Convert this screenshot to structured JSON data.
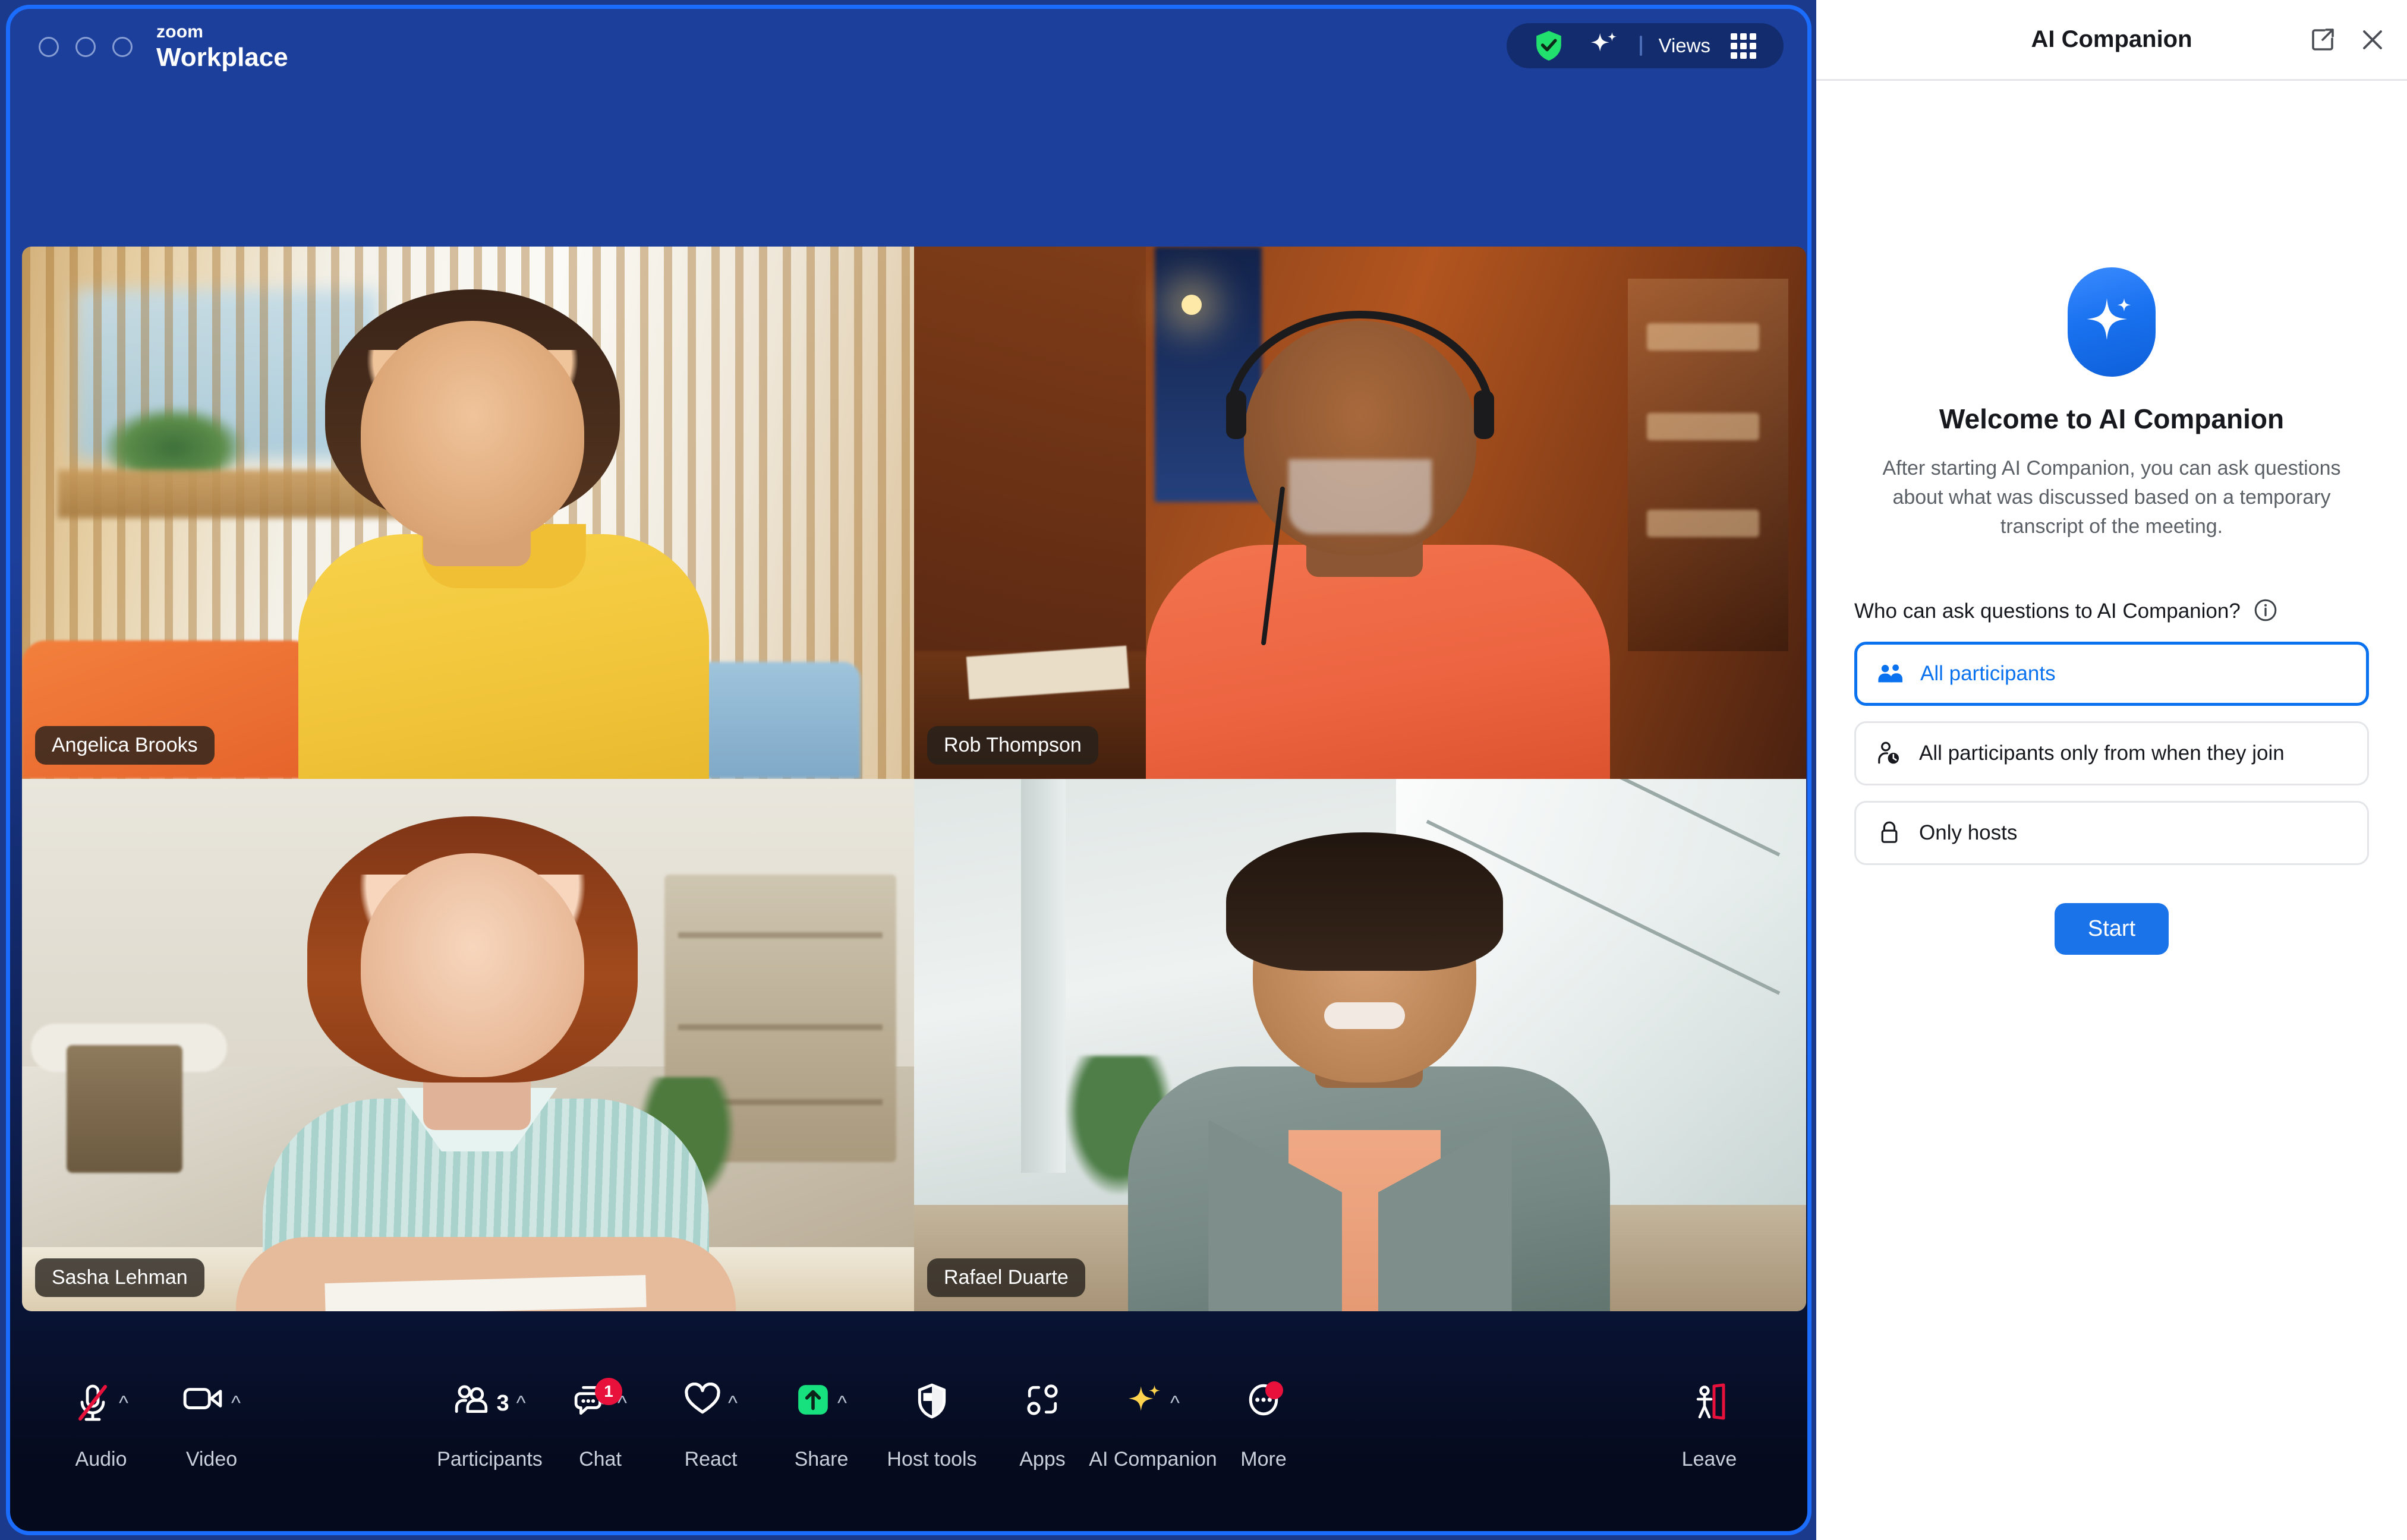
{
  "window": {
    "brand_line1": "zoom",
    "brand_line2": "Workplace",
    "traffic_lights": [
      "close",
      "minimize",
      "maximize"
    ]
  },
  "top_right_controls": {
    "encryption_icon": "shield-check-icon",
    "ai_icon": "ai-sparkle-icon",
    "views_label": "Views",
    "views_grid_icon": "grid-icon"
  },
  "video_grid": {
    "participants": [
      {
        "name": "Angelica Brooks"
      },
      {
        "name": "Rob Thompson"
      },
      {
        "name": "Sasha Lehman"
      },
      {
        "name": "Rafael Duarte"
      }
    ]
  },
  "toolbar": {
    "left": [
      {
        "label": "Audio",
        "icon": "microphone-muted-icon",
        "caret": "^",
        "muted": true
      },
      {
        "label": "Video",
        "icon": "video-camera-icon",
        "caret": "^"
      }
    ],
    "center": [
      {
        "label": "Participants",
        "icon": "participants-icon",
        "caret": "^",
        "count": "3"
      },
      {
        "label": "Chat",
        "icon": "chat-bubble-icon",
        "caret": "^",
        "badge": "1"
      },
      {
        "label": "React",
        "icon": "heart-icon",
        "caret": "^"
      },
      {
        "label": "Share",
        "icon": "share-screen-icon",
        "caret": "^"
      },
      {
        "label": "Host tools",
        "icon": "shield-icon"
      },
      {
        "label": "Apps",
        "icon": "apps-icon"
      },
      {
        "label": "AI Companion",
        "icon": "ai-sparkle-icon",
        "caret": "^"
      },
      {
        "label": "More",
        "icon": "more-ellipsis-icon",
        "dot_badge": true
      }
    ],
    "right": [
      {
        "label": "Leave",
        "icon": "leave-door-icon"
      }
    ]
  },
  "ai_panel": {
    "title": "AI Companion",
    "popout_icon": "popout-icon",
    "close_icon": "close-icon",
    "logo_icon": "ai-sparkle-icon",
    "welcome_title": "Welcome to AI Companion",
    "welcome_desc": "After starting AI Companion, you can ask questions about what was discussed based on a temporary transcript of the meeting.",
    "question_label": "Who can ask questions to AI Companion?",
    "info_icon": "info-icon",
    "options": [
      {
        "label": "All participants",
        "icon": "two-people-icon",
        "selected": true
      },
      {
        "label": "All participants only from when they join",
        "icon": "person-clock-icon",
        "selected": false
      },
      {
        "label": "Only hosts",
        "icon": "lock-icon",
        "selected": false
      }
    ],
    "start_label": "Start"
  },
  "colors": {
    "window_blue": "#1c3f9b",
    "window_border": "#1a6dff",
    "accent_blue": "#0b72ef",
    "start_button": "#1a73e8",
    "badge_red": "#e8113c",
    "share_green": "#17e07f",
    "ai_gold": "#ffd34d"
  }
}
